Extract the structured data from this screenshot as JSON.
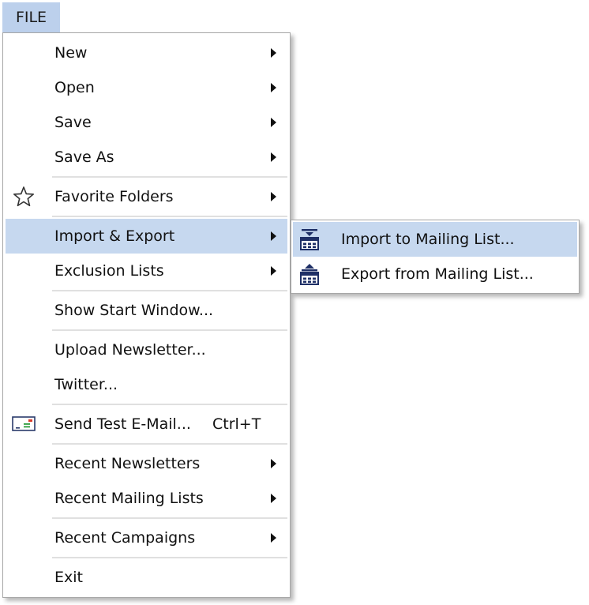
{
  "menubar": {
    "file_label": "FILE"
  },
  "menu": {
    "new": "New",
    "open": "Open",
    "save": "Save",
    "save_as": "Save As",
    "favorite_folders": "Favorite Folders",
    "import_export": "Import & Export",
    "exclusion_lists": "Exclusion Lists",
    "show_start_window": "Show Start Window...",
    "upload_newsletter": "Upload Newsletter...",
    "twitter": "Twitter...",
    "send_test_email": "Send Test E-Mail...",
    "send_test_email_shortcut": "Ctrl+T",
    "recent_newsletters": "Recent Newsletters",
    "recent_mailing_lists": "Recent Mailing Lists",
    "recent_campaigns": "Recent Campaigns",
    "exit": "Exit"
  },
  "submenu": {
    "import_to_mailing_list": "Import to Mailing List...",
    "export_from_mailing_list": "Export from Mailing List..."
  },
  "icons": {
    "favorite_folders": "star-icon",
    "send_test_email": "email-card-icon",
    "import": "import-list-icon",
    "export": "export-list-icon"
  },
  "colors": {
    "highlight": "#c6d8ef",
    "menubar_active": "#bcd0ec",
    "icon_navy": "#1e2f66"
  }
}
